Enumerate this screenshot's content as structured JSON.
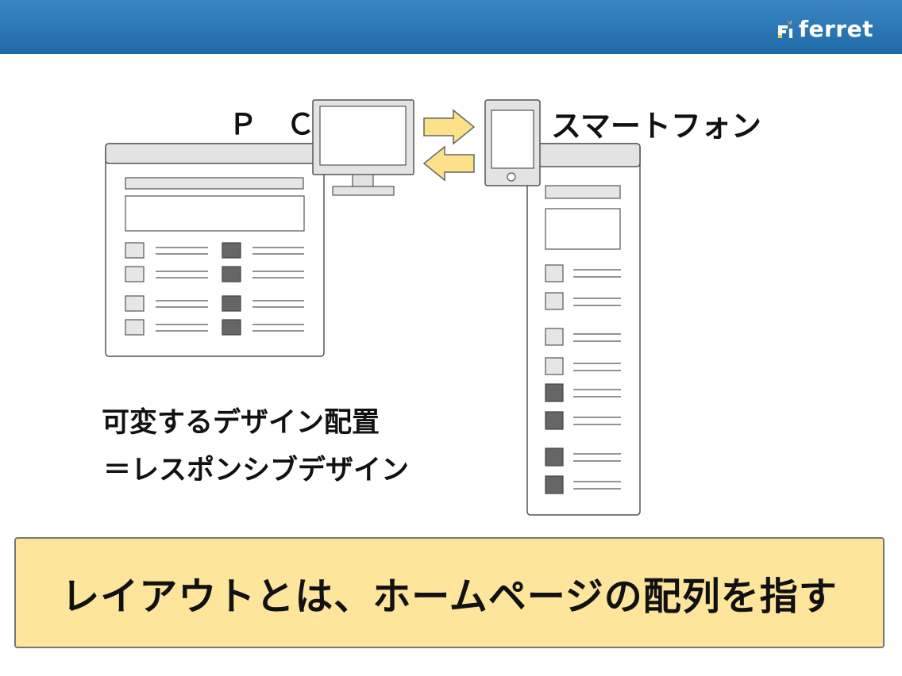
{
  "header": {
    "logo_text": "ferret",
    "bar_color": "#2874b5"
  },
  "diagram": {
    "pc_label": "Ｐ Ｃ",
    "smartphone_label": "スマートフォン",
    "caption_line1": "可変するデザイン配置",
    "caption_line2": "＝レスポンシブデザイン",
    "arrow_color": "#fde08a"
  },
  "summary": {
    "text": "レイアウトとは、ホームページの配列を指す",
    "background": "#fde59c"
  }
}
